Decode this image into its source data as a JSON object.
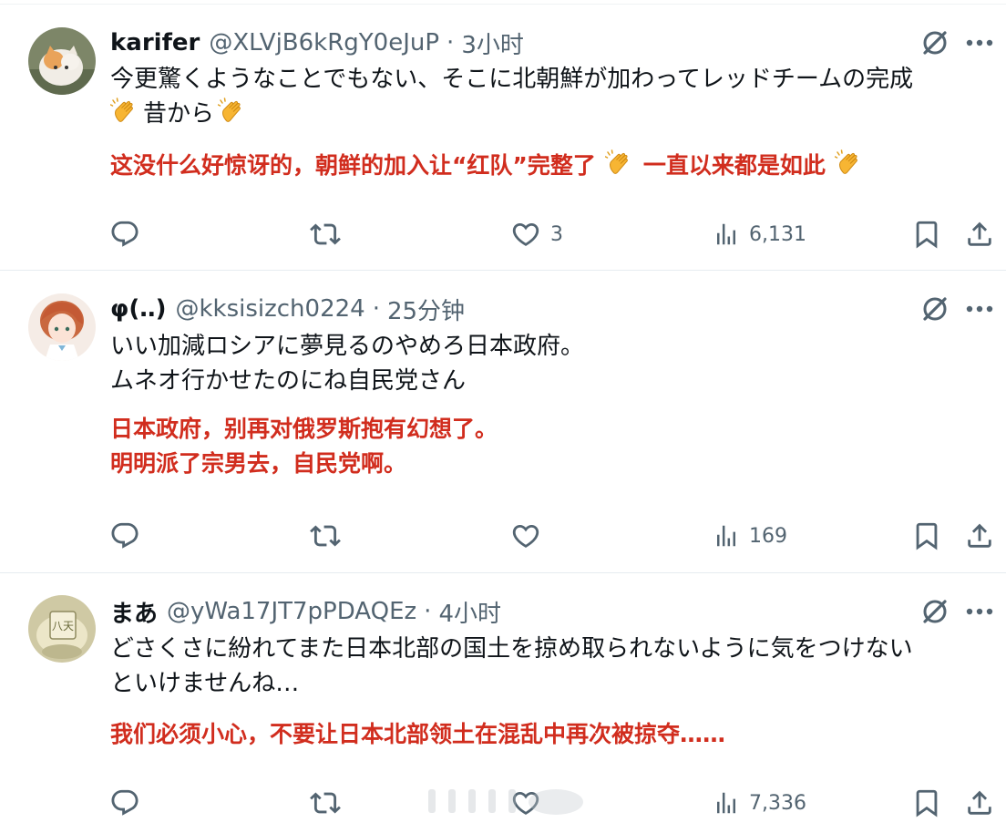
{
  "tweets": [
    {
      "name": "karifer",
      "handle": "@XLVjB6kRgY0eJuP",
      "dot": "·",
      "time": "3小时",
      "text_line1": "今更驚くようなことでもない、そこに北朝鮮が加わってレッドチームの完成",
      "text_line2_after_clap": "昔から",
      "translation": [
        "这没什么好惊讶的，朝鲜的加入让“红队”完整了",
        "一直以来都是如此"
      ],
      "likes": "3",
      "views": "6,131"
    },
    {
      "name": "φ(‥)",
      "handle": "@kksisizch0224",
      "dot": "·",
      "time": "25分钟",
      "text": [
        "いい加減ロシアに夢見るのやめろ日本政府。",
        "ムネオ行かせたのにね自民党さん"
      ],
      "translation": [
        "日本政府，别再对俄罗斯抱有幻想了。",
        "明明派了宗男去，自民党啊。"
      ],
      "likes": "",
      "views": "169"
    },
    {
      "name": "まあ",
      "handle": "@yWa17JT7pPDAQEz",
      "dot": "·",
      "time": "4小时",
      "text": [
        "どさくさに紛れてまた日本北部の国土を掠め取られないように気をつけない",
        "といけませんね…"
      ],
      "translation": [
        "我们必须小心，不要让日本北部领土在混乱中再次被掠夺……"
      ],
      "likes": "",
      "views": "7,336"
    }
  ],
  "colors": {
    "translation": "#d12d1e",
    "secondary_text": "#536471",
    "primary_text": "#0f1419",
    "separator": "#e6ecf0"
  },
  "icons": [
    "grok-icon",
    "more-icon",
    "reply-icon",
    "retweet-icon",
    "like-icon",
    "views-icon",
    "bookmark-icon",
    "share-icon",
    "clap-emoji"
  ]
}
